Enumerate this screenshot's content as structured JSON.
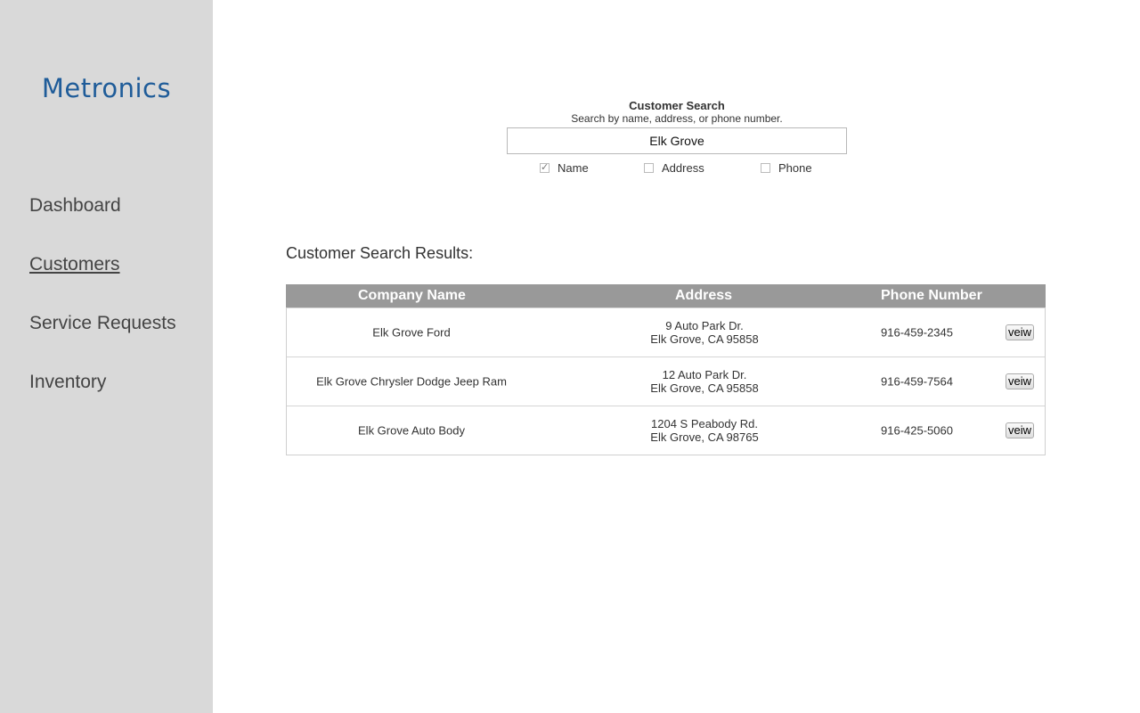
{
  "sidebar": {
    "logo": "Metronics",
    "items": [
      {
        "label": "Dashboard"
      },
      {
        "label": "Customers",
        "active": true
      },
      {
        "label": "Service Requests"
      },
      {
        "label": "Inventory"
      }
    ]
  },
  "search": {
    "title": "Customer Search",
    "subtitle": "Search by name, address, or phone number.",
    "value": "Elk Grove",
    "options": [
      {
        "label": "Name",
        "checked": true
      },
      {
        "label": "Address",
        "checked": false
      },
      {
        "label": "Phone",
        "checked": false
      }
    ]
  },
  "results": {
    "title": "Customer Search Results:",
    "columns": [
      "Company Name",
      "Address",
      "Phone Number"
    ],
    "rows": [
      {
        "name": "Elk Grove Ford",
        "address_line1": "9 Auto Park Dr.",
        "address_line2": "Elk Grove, CA 95858",
        "phone": "916-459-2345",
        "button": "veiw"
      },
      {
        "name": "Elk Grove Chrysler Dodge Jeep Ram",
        "address_line1": "12 Auto Park Dr.",
        "address_line2": "Elk Grove, CA 95858",
        "phone": "916-459-7564",
        "button": "veiw"
      },
      {
        "name": "Elk Grove Auto Body",
        "address_line1": "1204 S Peabody Rd.",
        "address_line2": "Elk Grove, CA 98765",
        "phone": "916-425-5060",
        "button": "veiw"
      }
    ]
  },
  "colors": {
    "sidebar_bg": "#d9d9d9",
    "logo": "#1f5c99",
    "table_header_bg": "#999999"
  }
}
